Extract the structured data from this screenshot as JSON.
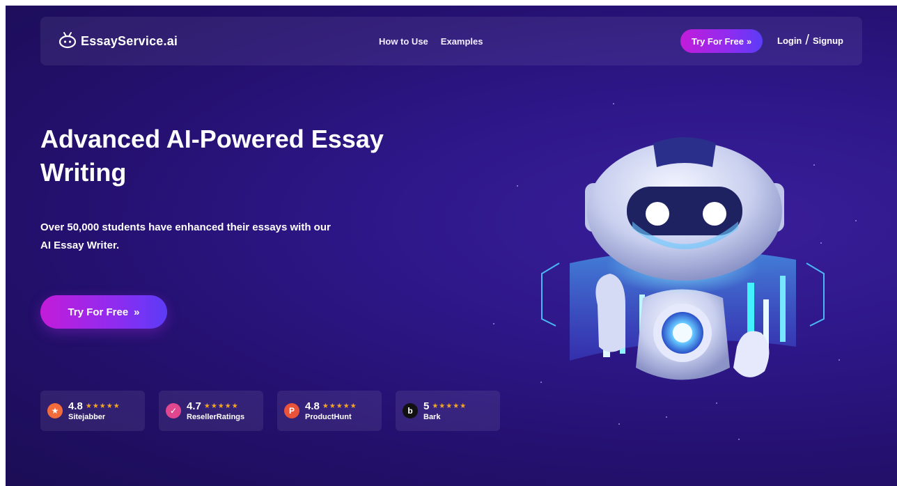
{
  "header": {
    "brand": "EssayService.ai",
    "nav": [
      "How to Use",
      "Examples"
    ],
    "try_label": "Try For Free",
    "login_label": "Login",
    "signup_label": "Signup"
  },
  "hero": {
    "title_line1": "Advanced AI-Powered Essay",
    "title_line2": "Writing",
    "subtitle_line1": "Over 50,000 students have enhanced their essays with our",
    "subtitle_line2": "AI Essay Writer.",
    "cta_label": "Try For Free"
  },
  "ratings": [
    {
      "score": "4.8",
      "source": "Sitejabber",
      "icon": "sitejabber-icon",
      "color": "#f36b3b",
      "glyph": "★"
    },
    {
      "score": "4.7",
      "source": "ResellerRatings",
      "icon": "resellerratings-icon",
      "color": "#e0478e",
      "glyph": "✓"
    },
    {
      "score": "4.8",
      "source": "ProductHunt",
      "icon": "producthunt-icon",
      "color": "#e8533a",
      "glyph": "P"
    },
    {
      "score": "5",
      "source": "Bark",
      "icon": "bark-icon",
      "color": "#111111",
      "glyph": "b"
    }
  ],
  "colors": {
    "accent_start": "#c21cd9",
    "accent_end": "#5b3cf6",
    "star": "#f5a623",
    "background": "#2d1788"
  }
}
